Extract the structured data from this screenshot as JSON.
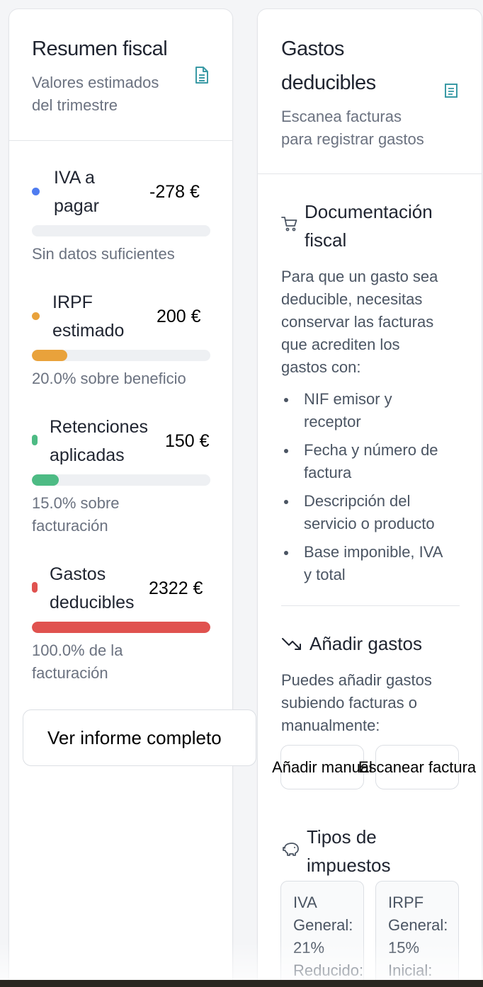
{
  "summary_card": {
    "title": "Resumen fiscal",
    "subtitle_line1": "Valores estimados",
    "subtitle_line2": "del trimestre",
    "icon": "document-icon",
    "metrics": [
      {
        "label_line1": "IVA a",
        "label_line2": "pagar",
        "value": "-278 €",
        "color": "#4f7cf0",
        "progress": 0,
        "note_line1": "Sin datos suficientes",
        "note_line2": ""
      },
      {
        "label_line1": "IRPF",
        "label_line2": "estimado",
        "value": "200 €",
        "color": "#e9a23b",
        "progress": 0.2,
        "note_line1": "20.0% sobre beneficio",
        "note_line2": ""
      },
      {
        "label_line1": "Retenciones",
        "label_line2": "aplicadas",
        "value": "150 €",
        "color": "#4dbb84",
        "progress": 0.15,
        "note_line1": "15.0% sobre",
        "note_line2": "facturación"
      },
      {
        "label_line1": "Gastos",
        "label_line2": "deducibles",
        "value": "2322 €",
        "color": "#e0524f",
        "progress": 1.0,
        "note_line1": "100.0% de la",
        "note_line2": "facturación"
      }
    ],
    "report_button_label": "Ver informe completo"
  },
  "expenses_card": {
    "title_line1": "Gastos",
    "title_line2": "deducibles",
    "subtitle_line1": "Escanea facturas",
    "subtitle_line2": "para registrar gastos",
    "icon": "receipt-icon",
    "documentation": {
      "icon": "cart-icon",
      "title_line1": "Documentación",
      "title_line2": "fiscal",
      "intro_lines": [
        "Para que un gasto sea",
        "deducible, necesitas",
        "conservar las facturas",
        "que acrediten los",
        "gastos con:"
      ],
      "requirements": [
        {
          "line1": "NIF emisor y",
          "line2": "receptor"
        },
        {
          "line1": "Fecha y número de",
          "line2": "factura"
        },
        {
          "line1": "Descripción del",
          "line2": "servicio o producto"
        },
        {
          "line1": "Base imponible, IVA",
          "line2": "y total"
        }
      ]
    },
    "add_expenses": {
      "icon": "trending-down-icon",
      "title": "Añadir gastos",
      "text_lines": [
        "Puedes añadir gastos",
        "subiendo facturas o",
        "manualmente:"
      ],
      "manual_button_label": "Añadir manual",
      "scan_button_label": "Escanear factura"
    },
    "tax_types": {
      "icon": "piggy-bank-icon",
      "title_line1": "Tipos de",
      "title_line2": "impuestos",
      "boxes": [
        {
          "lines": [
            "IVA",
            "General:",
            "21%",
            "Reducido:"
          ]
        },
        {
          "lines": [
            "IRPF",
            "General:",
            "15%",
            "Inicial:"
          ]
        }
      ]
    }
  }
}
